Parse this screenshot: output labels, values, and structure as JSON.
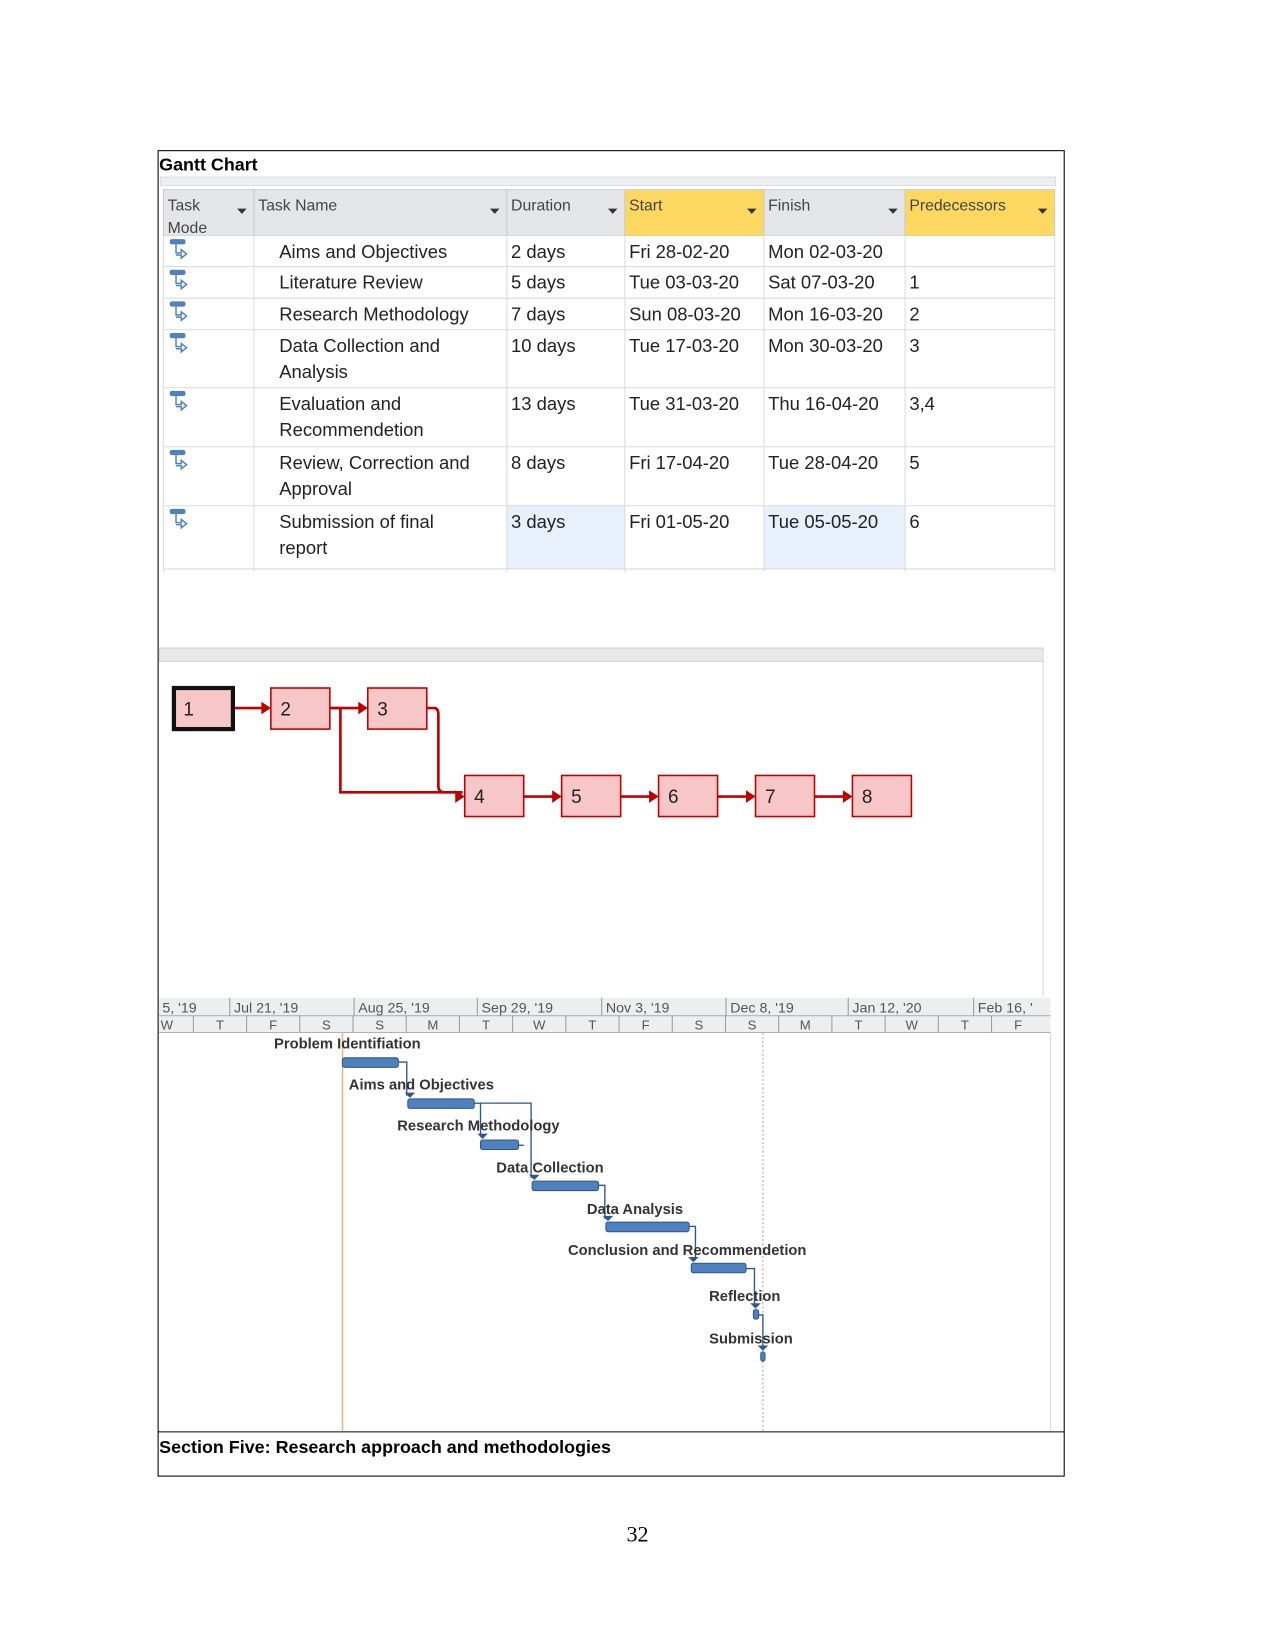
{
  "figure": {
    "title": "Gantt Chart",
    "caption": "Section Five: Research approach and methodologies"
  },
  "page_number": "32",
  "table": {
    "columns": [
      "Task Mode",
      "Task Name",
      "Duration",
      "Start",
      "Finish",
      "Predecessors"
    ],
    "column_mode_label_lines": [
      "Task",
      "Mode"
    ],
    "highlighted_columns": [
      "Start",
      "Predecessors"
    ],
    "highlight_color": "#fcd861",
    "task_mode_icon": "auto-scheduled-task-icon",
    "rows": [
      {
        "name": [
          "Aims and Objectives"
        ],
        "duration": "2 days",
        "start": "Fri 28-02-20",
        "finish": "Mon 02-03-20",
        "pred": ""
      },
      {
        "name": [
          "Literature Review"
        ],
        "duration": "5 days",
        "start": "Tue 03-03-20",
        "finish": "Sat 07-03-20",
        "pred": "1"
      },
      {
        "name": [
          "Research Methodology"
        ],
        "duration": "7 days",
        "start": "Sun 08-03-20",
        "finish": "Mon 16-03-20",
        "pred": "2"
      },
      {
        "name": [
          "Data Collection and",
          "Analysis"
        ],
        "duration": "10 days",
        "start": "Tue 17-03-20",
        "finish": "Mon 30-03-20",
        "pred": "3"
      },
      {
        "name": [
          "Evaluation and",
          "Recommendetion"
        ],
        "duration": "13 days",
        "start": "Tue 31-03-20",
        "finish": "Thu 16-04-20",
        "pred": "3,4"
      },
      {
        "name": [
          "Review, Correction and",
          "Approval"
        ],
        "duration": "8 days",
        "start": "Fri 17-04-20",
        "finish": "Tue 28-04-20",
        "pred": "5"
      },
      {
        "name": [
          "Submission of final",
          "report"
        ],
        "duration": "3 days",
        "start": "Fri 01-05-20",
        "finish": "Tue 05-05-20",
        "pred": "6"
      }
    ]
  },
  "network": {
    "nodes": [
      "1",
      "2",
      "3",
      "4",
      "5",
      "6",
      "7",
      "8"
    ],
    "node_fill": "#f7c6c6",
    "link_color": "#c00000"
  },
  "gantt": {
    "timescale_major": [
      "5, '19",
      "Jul 21, '19",
      "Aug 25, '19",
      "Sep 29, '19",
      "Nov 3, '19",
      "Dec 8, '19",
      "Jan 12, '20",
      "Feb 16, '"
    ],
    "timescale_minor": [
      "W",
      "T",
      "F",
      "S",
      "S",
      "M",
      "T",
      "W",
      "T",
      "F",
      "S",
      "S",
      "M",
      "T",
      "W",
      "T",
      "F"
    ],
    "bar_color": "#4f81bd",
    "tasks": [
      "Problem Identifiation",
      "Aims and Objectives",
      "Research Methodology",
      "Data Collection",
      "Data Analysis",
      "Conclusion and Recommendetion",
      "Reflection",
      "Submission"
    ]
  }
}
